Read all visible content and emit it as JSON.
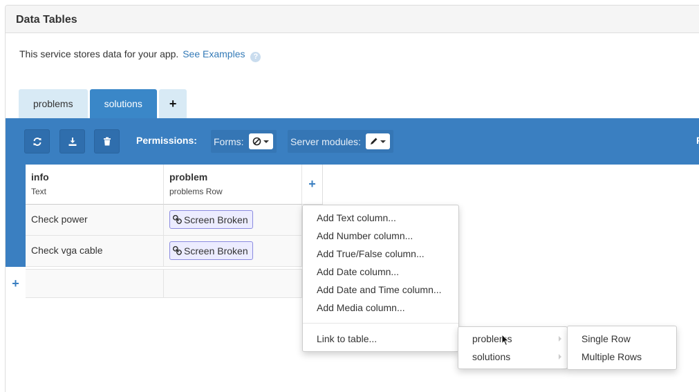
{
  "panel": {
    "title": "Data Tables"
  },
  "intro": {
    "text": "This service stores data for your app.",
    "link": "See Examples",
    "help": "?"
  },
  "tabs": [
    {
      "label": "problems"
    },
    {
      "label": "solutions"
    },
    {
      "label": "+"
    }
  ],
  "toolbar": {
    "refresh_icon": "refresh-icon",
    "download_icon": "download-icon",
    "delete_icon": "trash-icon",
    "permissions_label": "Permissions:",
    "forms_label": "Forms:",
    "forms_value_icon": "no-access-icon",
    "server_modules_label": "Server modules:",
    "server_modules_value_icon": "pencil-icon",
    "cutoff": "F"
  },
  "columns": [
    {
      "name": "info",
      "type": "Text"
    },
    {
      "name": "problem",
      "type": "problems Row"
    }
  ],
  "add_column": "+",
  "rows": [
    {
      "info": "Check power",
      "problem": "Screen Broken"
    },
    {
      "info": "Check vga cable",
      "problem": "Screen Broken"
    }
  ],
  "add_row": "+",
  "column_menu": {
    "items": [
      "Add Text column...",
      "Add Number column...",
      "Add True/False column...",
      "Add Date column...",
      "Add Date and Time column...",
      "Add Media column..."
    ],
    "link_item": "Link to table..."
  },
  "table_submenu": {
    "items": [
      "problems",
      "solutions"
    ]
  },
  "row_submenu": {
    "items": [
      "Single Row",
      "Multiple Rows"
    ]
  },
  "colors": {
    "toolbar": "#3a7fc1",
    "tab_active": "#3a87c8",
    "tab_inactive": "#d8eaf5",
    "link": "#337ab7"
  }
}
